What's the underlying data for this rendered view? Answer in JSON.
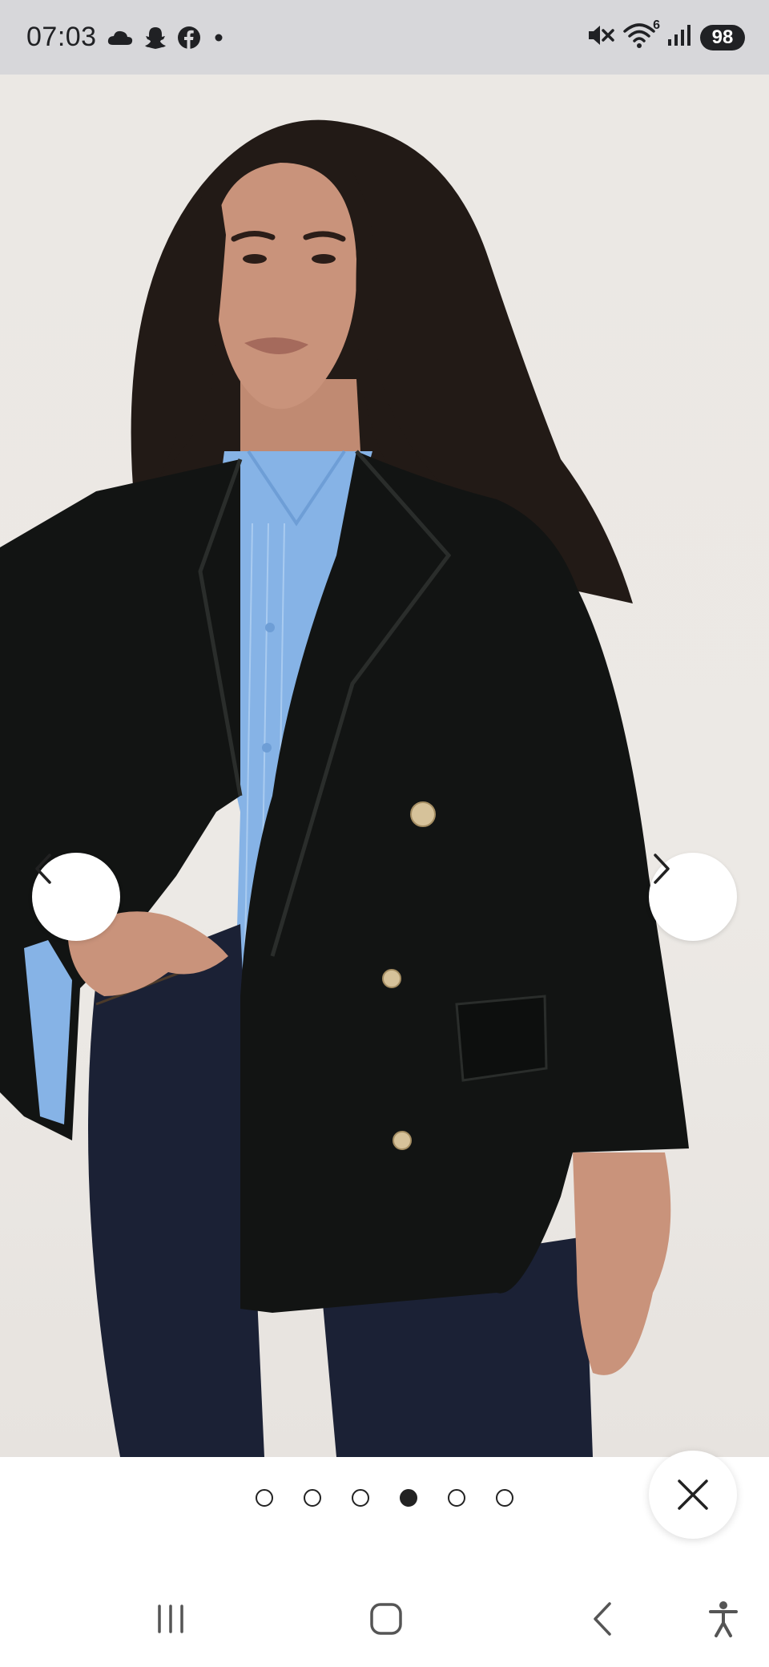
{
  "status_bar": {
    "time": "07:03",
    "notification_icons": [
      "cloud-icon",
      "snapchat-icon",
      "facebook-icon",
      "more-dot-icon"
    ],
    "system_icons": [
      "mute-icon",
      "wifi-icon",
      "signal-icon"
    ],
    "wifi_label": "6",
    "battery": "98"
  },
  "gallery": {
    "image_description_icon": "product-photo",
    "page_count": 6,
    "current_page": 4,
    "prev_icon": "chevron-left-icon",
    "next_icon": "chevron-right-icon",
    "close_icon": "close-icon"
  },
  "colors": {
    "background": "#ebe8e4",
    "blazer": "#121413",
    "shirt": "#86b3e6",
    "jeans": "#1b2135",
    "skin": "#c9937b",
    "hair": "#221a16"
  },
  "system_nav": {
    "recents_icon": "recents-icon",
    "home_icon": "home-icon",
    "back_icon": "back-icon",
    "accessibility_icon": "accessibility-icon"
  }
}
